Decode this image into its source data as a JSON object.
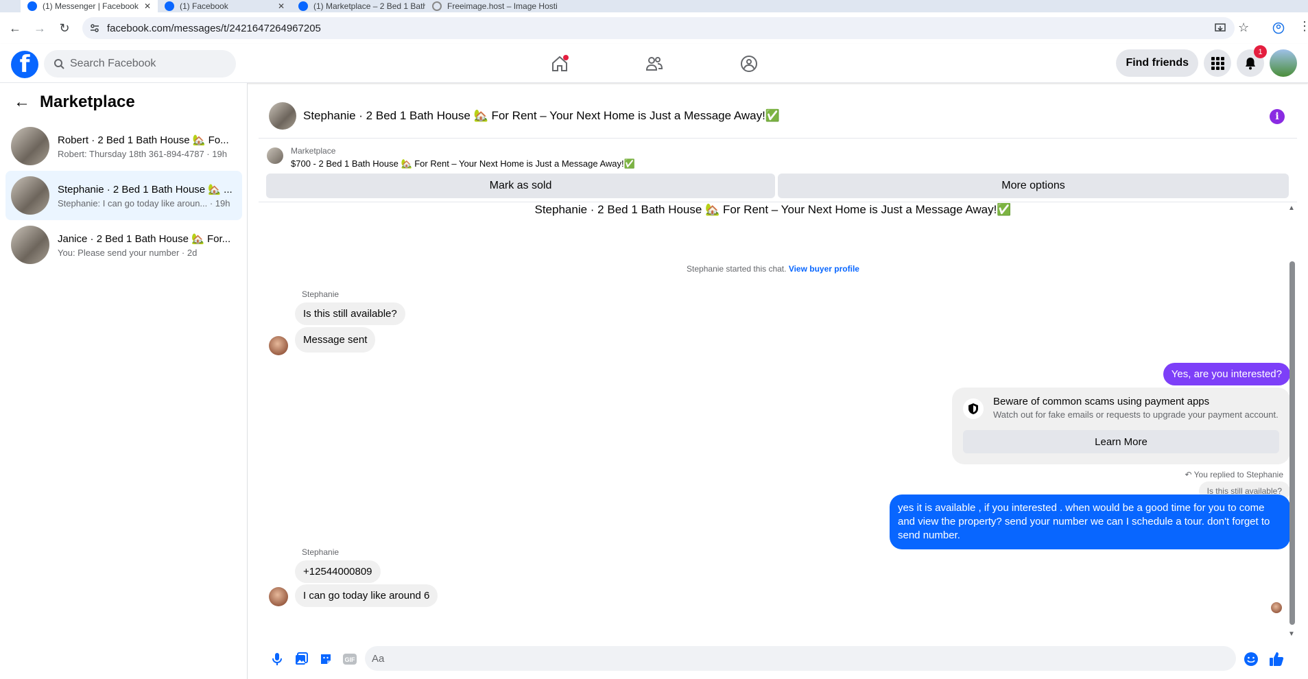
{
  "browser": {
    "tabs": [
      {
        "title": "(1) Messenger | Facebook"
      },
      {
        "title": "(1) Facebook"
      },
      {
        "title": "(1) Marketplace – 2 Bed 1 Bath"
      },
      {
        "title": "Freeimage.host – Image Hosti"
      }
    ],
    "url": "facebook.com/messages/t/2421647264967205"
  },
  "fb_header": {
    "search_placeholder": "Search Facebook",
    "find_friends": "Find friends",
    "notification_count": "1"
  },
  "sidebar": {
    "title": "Marketplace",
    "conversations": [
      {
        "title": "Robert · 2 Bed 1 Bath House 🏡 Fo...",
        "preview": "Robert: Thursday 18th 361-894-4787 · 19h"
      },
      {
        "title": "Stephanie · 2 Bed 1 Bath House 🏡 ...",
        "preview": "Stephanie: I can go today like aroun... · 19h"
      },
      {
        "title": "Janice · 2 Bed 1 Bath House 🏡 For...",
        "preview": "You: Please send your number · 2d"
      }
    ]
  },
  "chat": {
    "header_title": "Stephanie · 2 Bed 1 Bath House 🏡 For Rent – Your Next Home is Just a Message Away!✅",
    "marketplace_label": "Marketplace",
    "listing": "$700 - 2 Bed 1 Bath House 🏡 For Rent – Your Next Home is Just a Message Away!✅",
    "mark_sold": "Mark as sold",
    "more_options": "More options",
    "conversation_title": "Stephanie · 2 Bed 1 Bath House 🏡 For Rent – Your Next Home is Just a Message Away!✅",
    "started_text": "Stephanie started this chat.",
    "view_profile": "View buyer profile",
    "sender1": "Stephanie",
    "msg1": "Is this still available?",
    "msg2": "Message sent",
    "out1": "Yes, are you interested?",
    "scam_title": "Beware of common scams using payment apps",
    "scam_sub": "Watch out for fake emails or requests to upgrade your payment account.",
    "learn_more": "Learn More",
    "replied_label": "You replied to Stephanie",
    "quoted": "Is this still available?",
    "out2": "yes it is available , if you interested . when would    be  a good time for you to come and view the  property? send your number we can I schedule  a tour. don't forget to send  number.",
    "sender2": "Stephanie",
    "msg3": "+12544000809",
    "msg4": "I can go today like around 6",
    "composer_placeholder": "Aa"
  },
  "colors": {
    "fb_blue": "#0866ff",
    "purple_bubble": "#7d3ff8",
    "selected_bg": "#ebf5ff"
  }
}
